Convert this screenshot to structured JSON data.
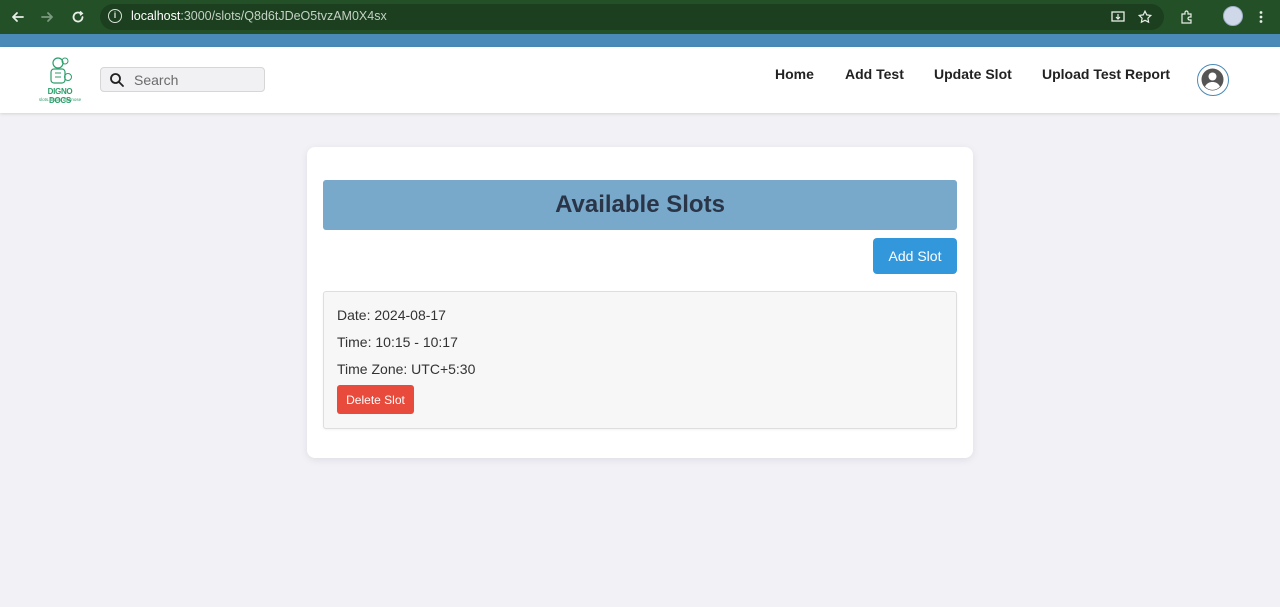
{
  "browser": {
    "url_host": "localhost",
    "url_path": ":3000/slots/Q8d6tJDeO5tvzAM0X4sx"
  },
  "app": {
    "logo_text": "DIGNO DOCS",
    "logo_tagline": "slots. book. diagnose",
    "search_placeholder": "Search",
    "nav": [
      {
        "label": "Home"
      },
      {
        "label": "Add Test"
      },
      {
        "label": "Update Slot"
      },
      {
        "label": "Upload Test Report"
      }
    ]
  },
  "main": {
    "title": "Available Slots",
    "add_slot_label": "Add Slot",
    "slots": [
      {
        "date_text": "Date: 2024-08-17",
        "time_text": "Time: 10:15 - 10:17",
        "timezone_text": "Time Zone: UTC+5:30",
        "delete_label": "Delete Slot"
      }
    ]
  },
  "colors": {
    "browser_frame": "#245028",
    "accent_strip": "#4a8ab8",
    "title_bar": "#78a9cb",
    "primary_button": "#3397dc",
    "danger_button": "#e84a3b"
  }
}
